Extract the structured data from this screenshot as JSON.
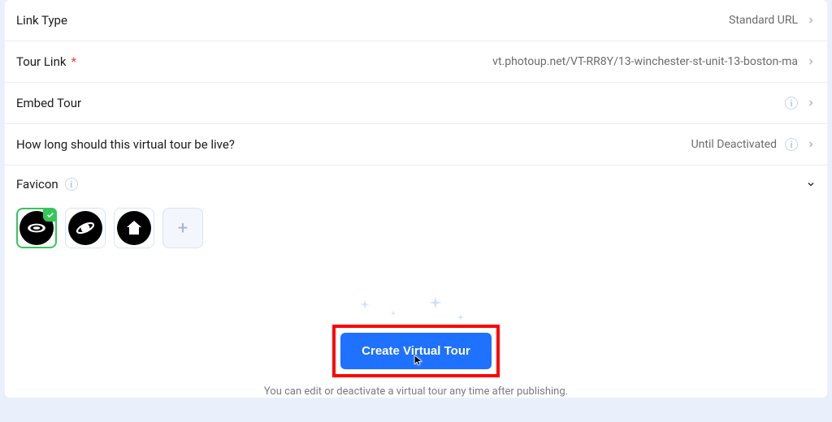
{
  "rows": {
    "link_type": {
      "label": "Link Type",
      "value": "Standard URL"
    },
    "tour_link": {
      "label": "Tour Link",
      "value": "vt.photoup.net/VT-RR8Y/13-winchester-st-unit-13-boston-ma"
    },
    "embed_tour": {
      "label": "Embed Tour"
    },
    "duration": {
      "label": "How long should this virtual tour be live?",
      "value": "Until Deactivated"
    }
  },
  "favicon": {
    "label": "Favicon",
    "selected_index": 0,
    "options": [
      "vr-icon",
      "orbit-icon",
      "house-icon"
    ]
  },
  "footer": {
    "cta": "Create Virtual Tour",
    "hint": "You can edit or deactivate a virtual tour any time after publishing."
  },
  "required_marker": "*"
}
